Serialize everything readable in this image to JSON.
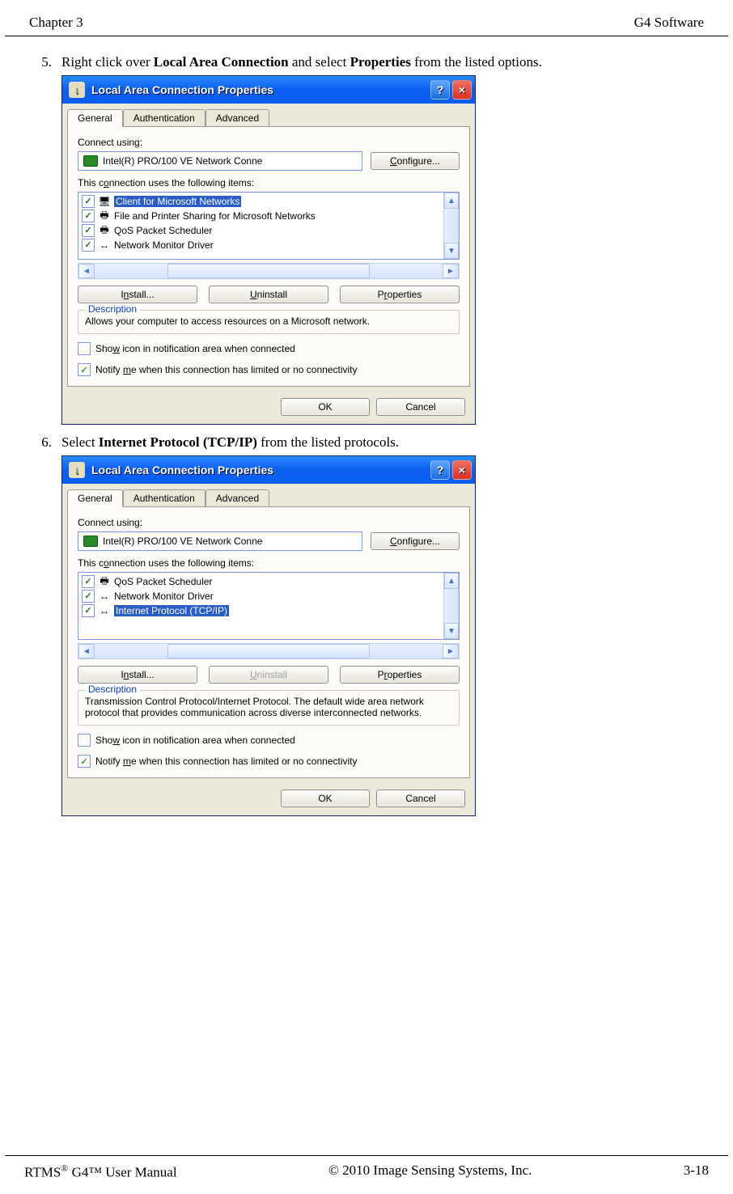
{
  "header": {
    "left": "Chapter 3",
    "right": "G4 Software"
  },
  "steps": {
    "s5": {
      "num": "5.",
      "pre": "Right click over ",
      "b1": "Local Area Connection",
      "mid": " and select ",
      "b2": "Properties",
      "post": " from the listed options."
    },
    "s6": {
      "num": "6.",
      "pre": "Select ",
      "b1": "Internet Protocol (TCP/IP)",
      "post": " from the listed protocols."
    }
  },
  "dialog": {
    "title": "Local Area Connection Properties",
    "helpGlyph": "?",
    "closeGlyph": "×",
    "tabs": {
      "general": "General",
      "auth": "Authentication",
      "adv": "Advanced"
    },
    "connectUsing": "Connect using:",
    "adapter": "Intel(R) PRO/100 VE Network Conne",
    "configure": "Configure...",
    "itemsLabel": "This connection uses the following items:",
    "install": "Install...",
    "uninstall": "Uninstall",
    "properties": "Properties",
    "descLegend": "Description",
    "showIcon": "Show icon in notification area when connected",
    "notify": "Notify me when this connection has limited or no connectivity",
    "ok": "OK",
    "cancel": "Cancel"
  },
  "dlg1": {
    "items": [
      {
        "label": "Client for Microsoft Networks",
        "selected": true,
        "icon": "🖥"
      },
      {
        "label": "File and Printer Sharing for Microsoft Networks",
        "selected": false,
        "icon": "🖶"
      },
      {
        "label": "QoS Packet Scheduler",
        "selected": false,
        "icon": "🖶"
      },
      {
        "label": "Network Monitor Driver",
        "selected": false,
        "icon": "↔"
      }
    ],
    "desc": "Allows your computer to access resources on a Microsoft network.",
    "uninstallDisabled": false
  },
  "dlg2": {
    "items": [
      {
        "label": "QoS Packet Scheduler",
        "selected": false,
        "icon": "🖶"
      },
      {
        "label": "Network Monitor Driver",
        "selected": false,
        "icon": "↔"
      },
      {
        "label": "Internet Protocol (TCP/IP)",
        "selected": true,
        "icon": "↔"
      }
    ],
    "desc": "Transmission Control Protocol/Internet Protocol. The default wide area network protocol that provides communication across diverse interconnected networks.",
    "uninstallDisabled": true
  },
  "footer": {
    "left_a": "RTMS",
    "left_b": " G4™ User Manual",
    "mid": "© 2010 Image Sensing Systems, Inc.",
    "right": "3-18"
  }
}
